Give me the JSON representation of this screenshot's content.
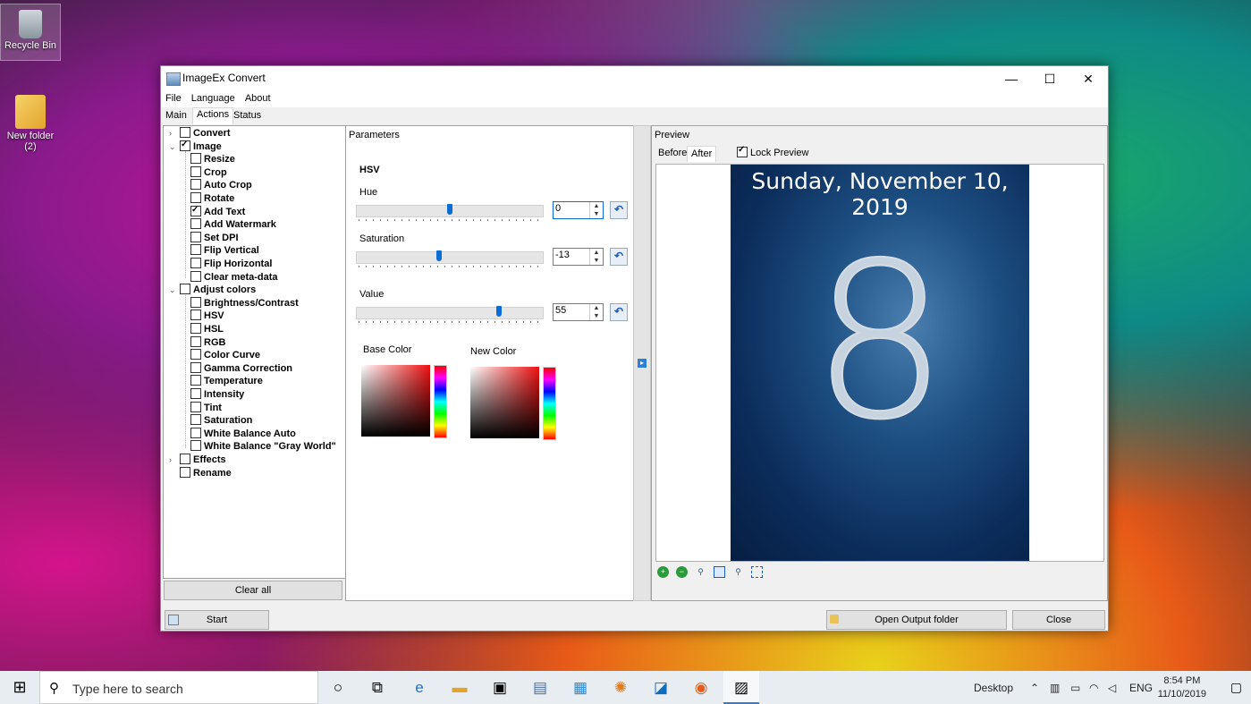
{
  "desktop": {
    "icons": [
      {
        "label": "Recycle Bin",
        "icon": "recycle-bin-icon"
      },
      {
        "label": "New folder (2)",
        "icon": "folder-icon"
      }
    ]
  },
  "window": {
    "title": "ImageEx Convert",
    "controls": {
      "minimize": "—",
      "maximize": "☐",
      "close": "✕"
    },
    "menu": [
      "File",
      "Language",
      "About"
    ],
    "tabs": [
      "Main",
      "Actions",
      "Status"
    ],
    "active_tab": "Actions"
  },
  "actions_tree": [
    {
      "label": "Convert",
      "checked": false,
      "level": 0,
      "expander": "›"
    },
    {
      "label": "Image",
      "checked": true,
      "level": 0,
      "expander": "⌄"
    },
    {
      "label": "Resize",
      "checked": false,
      "level": 1
    },
    {
      "label": "Crop",
      "checked": false,
      "level": 1
    },
    {
      "label": "Auto Crop",
      "checked": false,
      "level": 1
    },
    {
      "label": "Rotate",
      "checked": false,
      "level": 1
    },
    {
      "label": "Add Text",
      "checked": true,
      "level": 1
    },
    {
      "label": "Add Watermark",
      "checked": false,
      "level": 1
    },
    {
      "label": "Set DPI",
      "checked": false,
      "level": 1
    },
    {
      "label": "Flip Vertical",
      "checked": false,
      "level": 1
    },
    {
      "label": "Flip Horizontal",
      "checked": false,
      "level": 1
    },
    {
      "label": "Clear meta-data",
      "checked": false,
      "level": 1
    },
    {
      "label": "Adjust colors",
      "checked": false,
      "level": 0,
      "expander": "⌄"
    },
    {
      "label": "Brightness/Contrast",
      "checked": false,
      "level": 1
    },
    {
      "label": "HSV",
      "checked": false,
      "level": 1
    },
    {
      "label": "HSL",
      "checked": false,
      "level": 1
    },
    {
      "label": "RGB",
      "checked": false,
      "level": 1
    },
    {
      "label": "Color Curve",
      "checked": false,
      "level": 1
    },
    {
      "label": "Gamma Correction",
      "checked": false,
      "level": 1
    },
    {
      "label": "Temperature",
      "checked": false,
      "level": 1
    },
    {
      "label": "Intensity",
      "checked": false,
      "level": 1
    },
    {
      "label": "Tint",
      "checked": false,
      "level": 1
    },
    {
      "label": "Saturation",
      "checked": false,
      "level": 1
    },
    {
      "label": "White Balance Auto",
      "checked": false,
      "level": 1
    },
    {
      "label": "White Balance \"Gray World\"",
      "checked": false,
      "level": 1
    },
    {
      "label": "Effects",
      "checked": false,
      "level": 0,
      "expander": "›"
    },
    {
      "label": "Rename",
      "checked": false,
      "level": 0
    }
  ],
  "clear_all_label": "Clear all",
  "parameters": {
    "header": "Parameters",
    "section": "HSV",
    "sliders": [
      {
        "label": "Hue",
        "value": "0",
        "level": 0.5
      },
      {
        "label": "Saturation",
        "value": "-13",
        "level": 0.44
      },
      {
        "label": "Value",
        "value": "55",
        "level": 0.77
      }
    ],
    "base_color_label": "Base Color",
    "new_color_label": "New Color"
  },
  "preview": {
    "header": "Preview",
    "tabs": [
      "Before",
      "After"
    ],
    "active_tab": "After",
    "lock_preview_label": "Lock Preview",
    "lock_preview_checked": true,
    "image_date_text": "Sunday, November 10, 2019",
    "image_digit": "8",
    "tools": [
      "zoom-in-icon",
      "zoom-out-icon",
      "search-icon",
      "fit-window-icon",
      "zoom-tool-icon",
      "actual-size-icon"
    ]
  },
  "buttons": {
    "start": "Start",
    "open_output": "Open Output folder",
    "close": "Close"
  },
  "taskbar": {
    "search_placeholder": "Type here to search",
    "desktop_label": "Desktop",
    "language": "ENG",
    "time": "8:54 PM",
    "date": "11/10/2019"
  }
}
